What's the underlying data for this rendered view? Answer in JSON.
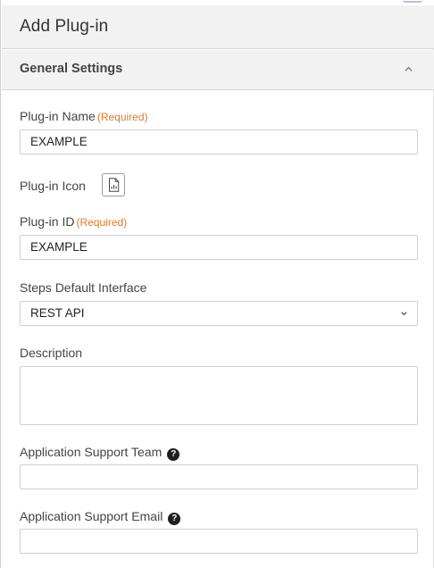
{
  "header": {
    "title": "Add Plug-in"
  },
  "section": {
    "title": "General Settings",
    "state_icon": "chevron-up-icon"
  },
  "fields": {
    "plugin_name": {
      "label": "Plug-in Name",
      "required": "(Required)",
      "value": "EXAMPLE"
    },
    "plugin_icon": {
      "label": "Plug-in Icon",
      "icon": "document-chart-icon"
    },
    "plugin_id": {
      "label": "Plug-in ID",
      "required": "(Required)",
      "value": "EXAMPLE"
    },
    "steps_interface": {
      "label": "Steps Default Interface",
      "value": "REST API"
    },
    "description": {
      "label": "Description",
      "value": ""
    },
    "support_team": {
      "label": "Application Support Team",
      "value": "",
      "help_icon": "question-circle-icon"
    },
    "support_email": {
      "label": "Application Support Email",
      "value": "",
      "help_icon": "question-circle-icon"
    }
  },
  "colors": {
    "required": "#e07a2c",
    "header_bg": "#f2f2f2",
    "border": "#cfcfcf"
  }
}
